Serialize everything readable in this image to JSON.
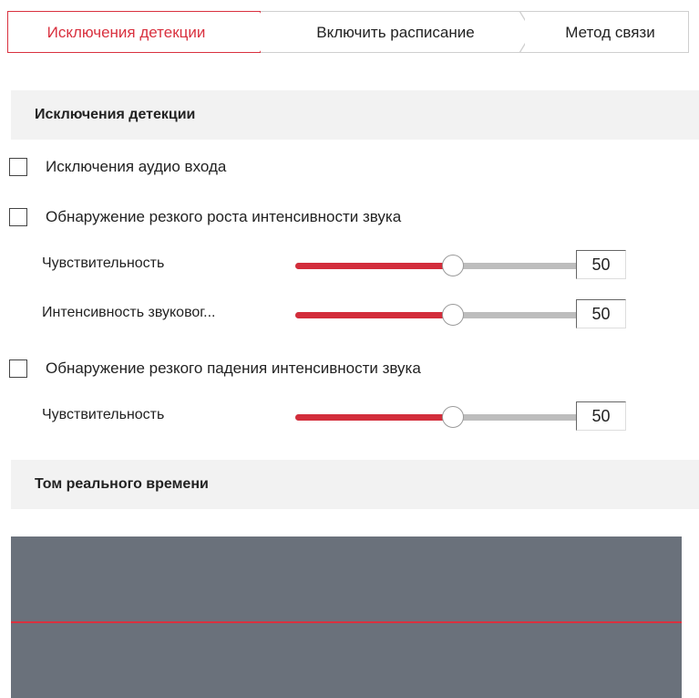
{
  "tabs": [
    {
      "label": "Исключения детекции",
      "active": true
    },
    {
      "label": "Включить расписание",
      "active": false
    },
    {
      "label": "Метод связи",
      "active": false
    }
  ],
  "sections": {
    "detection_exceptions": "Исключения детекции",
    "realtime_volume": "Том реального времени"
  },
  "checkboxes": {
    "audio_input_exception": {
      "label": "Исключения аудио входа",
      "checked": false
    },
    "sudden_rise": {
      "label": "Обнаружение резкого роста интенсивности звука",
      "checked": false
    },
    "sudden_drop": {
      "label": "Обнаружение резкого падения интенсивности звука",
      "checked": false
    }
  },
  "sliders": {
    "rise_sensitivity": {
      "label": "Чувствительность",
      "value": "50",
      "fraction": 0.5
    },
    "rise_intensity": {
      "label": "Интенсивность звуковог...",
      "value": "50",
      "fraction": 0.5
    },
    "drop_sensitivity": {
      "label": "Чувствительность",
      "value": "50",
      "fraction": 0.5
    }
  },
  "colors": {
    "accent": "#d9313f",
    "track_fill": "#d32d3b",
    "track": "#bdbdbd",
    "volume_bg": "#6a717b",
    "section_bg": "#f2f2f2"
  }
}
